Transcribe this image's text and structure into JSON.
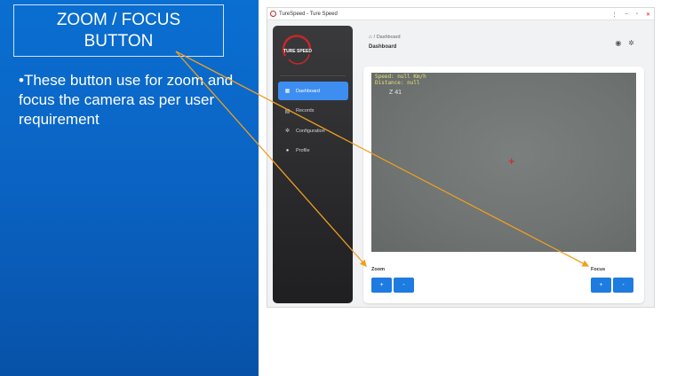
{
  "slide": {
    "callout_title_line1": "ZOOM / FOCUS",
    "callout_title_line2": "BUTTON",
    "description": "•These button use for zoom and focus the camera as per user requirement"
  },
  "window": {
    "title": "TureSpeed - Ture Speed",
    "controls": [
      "⋮",
      "–",
      "▫",
      "✕"
    ]
  },
  "sidebar": {
    "logo_text": "TURE SPEED",
    "items": [
      {
        "label": "Dashboard",
        "icon": "grid-icon",
        "active": true
      },
      {
        "label": "Records",
        "icon": "database-icon",
        "active": false
      },
      {
        "label": "Configuration",
        "icon": "gear-icon",
        "active": false
      },
      {
        "label": "Profile",
        "icon": "person-icon",
        "active": false
      }
    ]
  },
  "header": {
    "breadcrumb": "Dashboard",
    "page_title": "Dashboard"
  },
  "camera": {
    "speed_text": "Speed: null Km/h",
    "distance_text": "Distance: null",
    "zoom_level": "Z 41"
  },
  "controls": {
    "zoom_label": "Zoom",
    "focus_label": "Focus",
    "plus": "+",
    "minus": "-"
  },
  "colors": {
    "slide_blue": "#0b64c4",
    "accent": "#1e7be0",
    "arrow": "#f0a020",
    "crosshair": "#e01818"
  }
}
